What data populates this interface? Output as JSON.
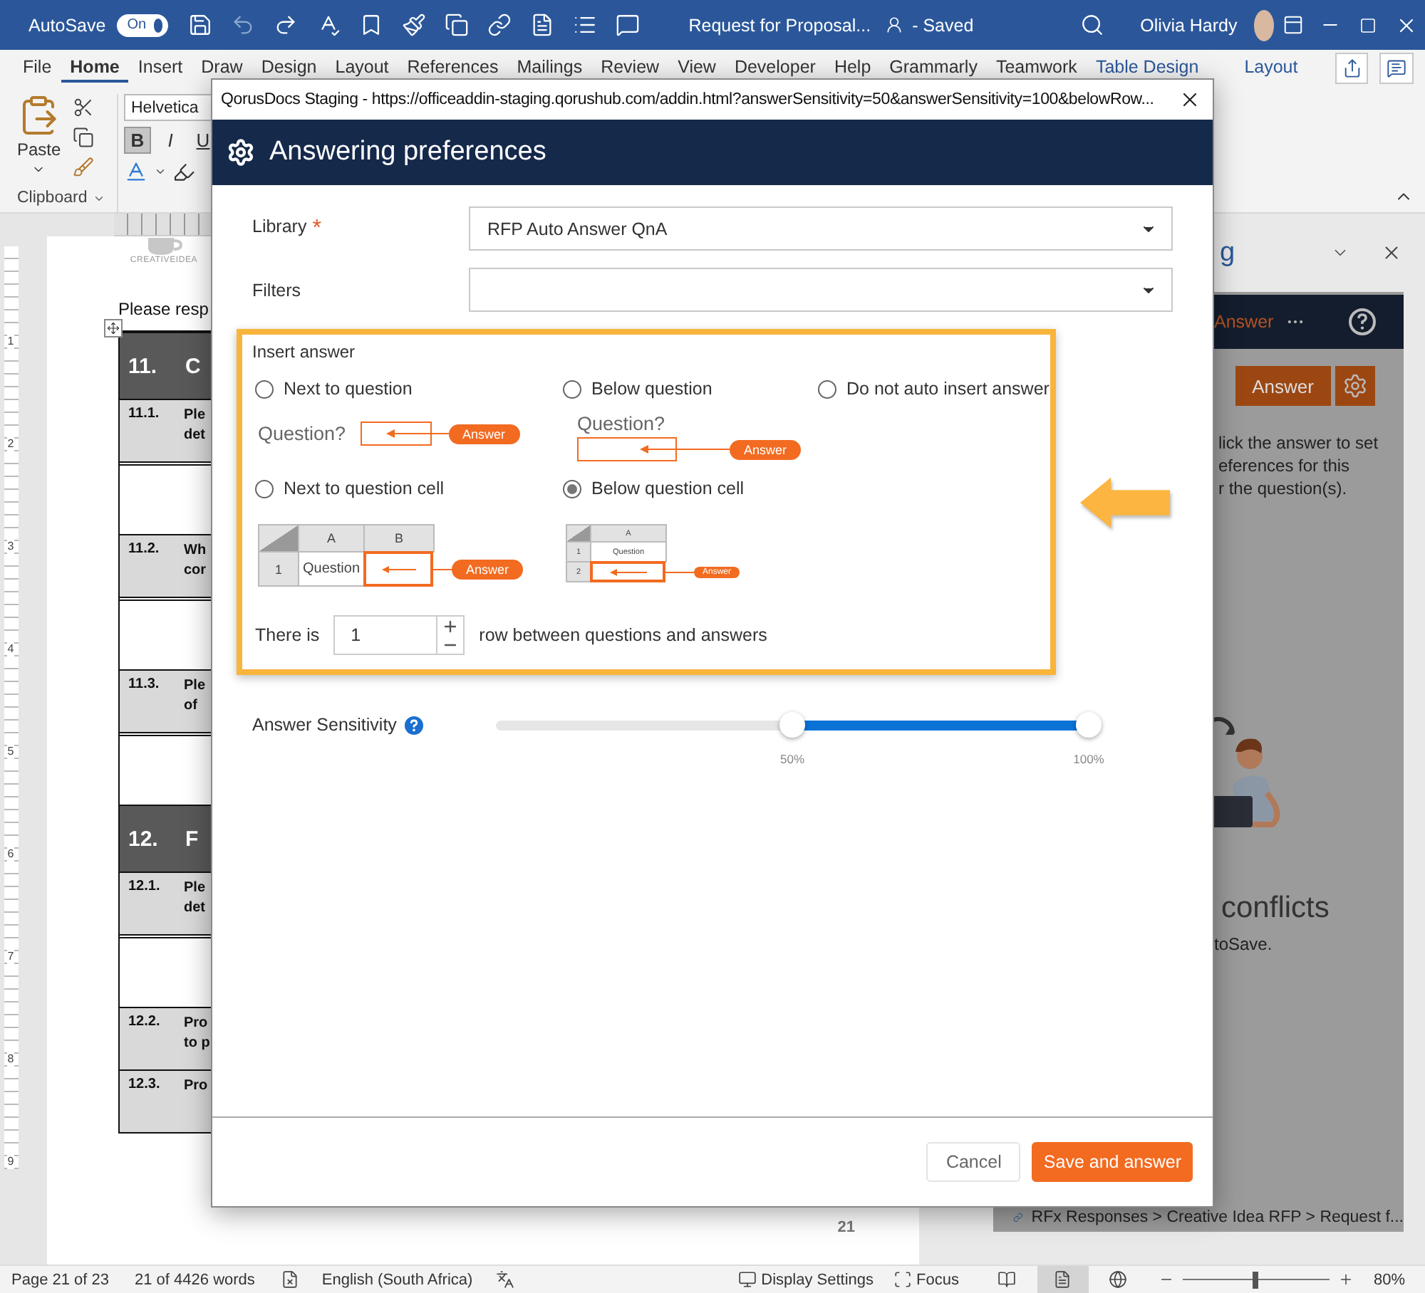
{
  "word": {
    "title_bar": {
      "autosave_label": "AutoSave",
      "autosave_toggle": {
        "label": "On",
        "on": true
      },
      "document_title": "Request for Proposal...",
      "save_status": "- Saved",
      "user_name": "Olivia Hardy"
    },
    "ribbon_tabs": [
      {
        "label": "File",
        "selected": false,
        "contextual": false
      },
      {
        "label": "Home",
        "selected": true,
        "contextual": false
      },
      {
        "label": "Insert",
        "selected": false,
        "contextual": false
      },
      {
        "label": "Draw",
        "selected": false,
        "contextual": false
      },
      {
        "label": "Design",
        "selected": false,
        "contextual": false
      },
      {
        "label": "Layout",
        "selected": false,
        "contextual": false
      },
      {
        "label": "References",
        "selected": false,
        "contextual": false
      },
      {
        "label": "Mailings",
        "selected": false,
        "contextual": false
      },
      {
        "label": "Review",
        "selected": false,
        "contextual": false
      },
      {
        "label": "View",
        "selected": false,
        "contextual": false
      },
      {
        "label": "Developer",
        "selected": false,
        "contextual": false
      },
      {
        "label": "Help",
        "selected": false,
        "contextual": false
      },
      {
        "label": "Grammarly",
        "selected": false,
        "contextual": false
      },
      {
        "label": "Teamwork",
        "selected": false,
        "contextual": false
      },
      {
        "label": "Table Design",
        "selected": false,
        "contextual": true
      },
      {
        "label": "Layout",
        "selected": false,
        "contextual": true
      }
    ],
    "ribbon": {
      "paste_label": "Paste",
      "font_name": "Helvetica",
      "format_buttons": [
        {
          "label": "B",
          "selected": true
        },
        {
          "label": "I",
          "selected": false
        },
        {
          "label": "U",
          "selected": false
        }
      ],
      "group_label": "Clipboard"
    },
    "ruler_numbers": [
      "1",
      "2",
      "3",
      "4",
      "5",
      "6",
      "7",
      "8",
      "9"
    ],
    "document": {
      "logo_text": "CREATIVEIDEA",
      "intro": "Please resp",
      "rows": [
        {
          "kind": "section",
          "number": "11.",
          "text": "C"
        },
        {
          "kind": "question",
          "number": "11.1.",
          "lines": [
            "Ple",
            "det"
          ]
        },
        {
          "kind": "answer"
        },
        {
          "kind": "question",
          "number": "11.2.",
          "lines": [
            "Wh",
            "cor"
          ]
        },
        {
          "kind": "answer"
        },
        {
          "kind": "question",
          "number": "11.3.",
          "lines": [
            "Ple",
            "of"
          ]
        },
        {
          "kind": "answer"
        },
        {
          "kind": "section",
          "number": "12.",
          "text": "F"
        },
        {
          "kind": "question",
          "number": "12.1.",
          "lines": [
            "Ple",
            "det"
          ]
        },
        {
          "kind": "answer"
        },
        {
          "kind": "question",
          "number": "12.2.",
          "lines": [
            "Pro",
            "to p"
          ]
        },
        {
          "kind": "question",
          "number": "12.3.",
          "lines": [
            "Pro"
          ]
        }
      ],
      "page_number": "21"
    },
    "task_pane": {
      "title": "g",
      "tab_label": "Answer",
      "answer_button": "Answer",
      "help_lines": [
        "lick the answer to set",
        "eferences for this",
        "r the question(s)."
      ],
      "heading": "conflicts",
      "note": "toSave.",
      "breadcrumb": "RFx Responses > Creative Idea RFP > Request f..."
    },
    "status_bar": {
      "page": "Page 21 of 23",
      "words": "21 of 4426 words",
      "language": "English (South Africa)",
      "display_settings": "Display Settings",
      "focus": "Focus",
      "views": [
        {
          "kind": "read",
          "selected": false
        },
        {
          "kind": "print",
          "selected": true
        },
        {
          "kind": "web",
          "selected": false
        }
      ],
      "zoom": {
        "level": 0.5,
        "label": "80%"
      }
    }
  },
  "dialog": {
    "window_title": "QorusDocs Staging - https://officeaddin-staging.qorushub.com/addin.html?answerSensitivity=50&answerSensitivity=100&belowRow...",
    "heading": "Answering preferences",
    "fields": [
      {
        "label": "Library",
        "required_mark": "*",
        "value": "RFP Auto Answer QnA"
      },
      {
        "label": "Filters"
      }
    ],
    "insert_answer": {
      "title": "Insert answer",
      "option_rows": [
        [
          {
            "label": "Next to question",
            "selected": false,
            "illustration": {
              "kind": "inline",
              "question": "Question?",
              "answer": "Answer"
            }
          },
          {
            "label": "Below question",
            "selected": false,
            "illustration": {
              "kind": "below",
              "question": "Question?",
              "answer": "Answer"
            }
          },
          {
            "label": "Do not auto insert answer",
            "selected": false
          }
        ],
        [
          {
            "label": "Next to question cell",
            "selected": false,
            "illustration": {
              "kind": "table_side",
              "columns": [
                "A",
                "B"
              ],
              "rows": [
                "1"
              ],
              "question": "Question",
              "answer": "Answer"
            }
          },
          {
            "label": "Below question cell",
            "selected": true,
            "illustration": {
              "kind": "table_below",
              "columns": [
                "A"
              ],
              "rows": [
                "1",
                "2"
              ],
              "question": "Question",
              "answer": "Answer"
            }
          }
        ]
      ],
      "rows_between": {
        "prefix": "There is",
        "value": "1",
        "suffix": "row between questions and answers"
      }
    },
    "sensitivity": {
      "label": "Answer Sensitivity",
      "thumbs": [
        {
          "level": 0.5,
          "label": "50%"
        },
        {
          "level": 1,
          "label": "100%"
        }
      ]
    },
    "buttons": [
      {
        "label": "Cancel",
        "kind": "secondary"
      },
      {
        "label": "Save and answer",
        "kind": "primary"
      }
    ]
  }
}
